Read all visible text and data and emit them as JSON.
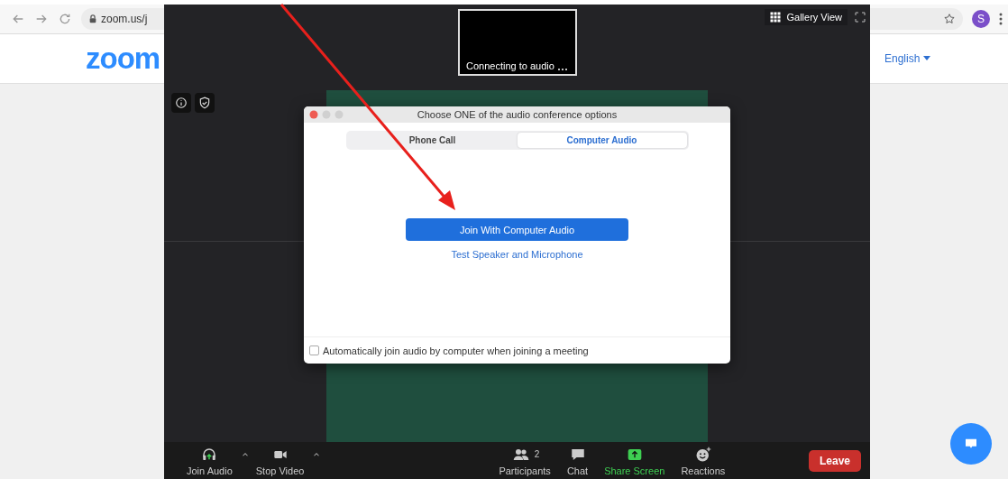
{
  "browser": {
    "address": "zoom.us/j",
    "profile_initial": "S",
    "language": "English"
  },
  "logo": "zoom",
  "meeting": {
    "self_view_label": "Connecting to audio",
    "view_button": "Gallery View"
  },
  "dialog": {
    "title": "Choose ONE of the audio conference options",
    "tabs": [
      {
        "label": "Phone Call",
        "selected": false
      },
      {
        "label": "Computer Audio",
        "selected": true
      }
    ],
    "primary_button": "Join With Computer Audio",
    "link": "Test Speaker and Microphone",
    "checkbox": {
      "label": "Automatically join audio by computer when joining a meeting",
      "checked": false
    }
  },
  "toolbar": {
    "items": [
      {
        "kind": "audio",
        "label": "Join Audio",
        "caret": true,
        "highlighted": false
      },
      {
        "kind": "video",
        "label": "Stop Video",
        "caret": true,
        "highlighted": false
      },
      {
        "kind": "participants",
        "label": "Participants",
        "count": "2",
        "caret": false,
        "highlighted": false
      },
      {
        "kind": "chat",
        "label": "Chat",
        "caret": false,
        "highlighted": false
      },
      {
        "kind": "share",
        "label": "Share Screen",
        "caret": false,
        "highlighted": true
      },
      {
        "kind": "reactions",
        "label": "Reactions",
        "caret": false,
        "highlighted": false
      }
    ],
    "leave": "Leave"
  }
}
